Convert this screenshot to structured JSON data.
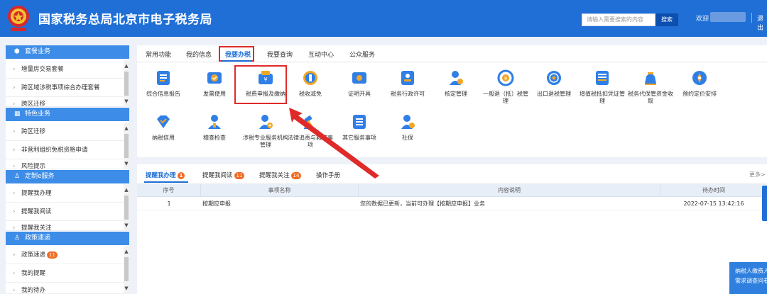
{
  "header": {
    "title": "国家税务总局北京市电子税务局",
    "search_placeholder": "请输入需要搜索的内容",
    "search_label": "搜索",
    "welcome": "欢迎",
    "logout": "退出",
    "brand_color": "#1f6fd6"
  },
  "sidebar": {
    "sections": [
      {
        "title": "套餐业务",
        "icon": "cube-icon",
        "items": [
          "增量房交易套餐",
          "跨区域涉税事项综合办理套餐",
          "跨区迁移"
        ]
      },
      {
        "title": "特色业务",
        "icon": "grid-icon",
        "items": [
          "跨区迁移",
          "非营利组织免税资格申请",
          "风险提示"
        ]
      },
      {
        "title": "定制e服务",
        "icon": "user-icon",
        "items": [
          "提醒我办理",
          "提醒我阅读",
          "提醒我关注"
        ]
      },
      {
        "title": "政策速递",
        "icon": "user-icon",
        "items": [
          "政策速递",
          "我的提醒",
          "我的待办"
        ],
        "badge": "11"
      }
    ]
  },
  "main_tabs": [
    "常用功能",
    "我的信息",
    "我要办税",
    "我要查询",
    "互动中心",
    "公众服务"
  ],
  "active_tab": "我要办税",
  "functions": [
    {
      "label": "综合信息报告",
      "icon": "document-icon"
    },
    {
      "label": "发票使用",
      "icon": "invoice-icon"
    },
    {
      "label": "税费申报及缴纳",
      "icon": "wallet-icon"
    },
    {
      "label": "税收减免",
      "icon": "coin-icon"
    },
    {
      "label": "证明开具",
      "icon": "certificate-icon"
    },
    {
      "label": "税务行政许可",
      "icon": "id-card-icon"
    },
    {
      "label": "核定管理",
      "icon": "person-icon"
    },
    {
      "label": "一般退（抵）税管理",
      "icon": "refund-icon"
    },
    {
      "label": "出口退税管理",
      "icon": "globe-icon"
    },
    {
      "label": "增值税抵扣凭证管理",
      "icon": "ledger-icon"
    },
    {
      "label": "税务代保管资金收取",
      "icon": "money-bag-icon"
    },
    {
      "label": "预约定价安排",
      "icon": "compass-icon"
    },
    {
      "label": "纳税信用",
      "icon": "diamond-icon"
    },
    {
      "label": "稽查检查",
      "icon": "inspector-icon"
    },
    {
      "label": "涉税专业服务机构管理",
      "icon": "agent-icon"
    },
    {
      "label": "法律追责与救济事项",
      "icon": "gavel-icon"
    },
    {
      "label": "其它服务事项",
      "icon": "list-icon"
    },
    {
      "label": "社保",
      "icon": "social-security-icon"
    }
  ],
  "reminder_tabs": [
    {
      "label": "提醒我办理",
      "badge": "1"
    },
    {
      "label": "提醒我阅读",
      "badge": "11"
    },
    {
      "label": "提醒我关注",
      "badge": "14"
    },
    {
      "label": "操作手册",
      "badge": ""
    }
  ],
  "more": "更多>",
  "table": {
    "headers": [
      "序号",
      "事项名称",
      "内容说明",
      "待办时间"
    ],
    "rows": [
      [
        "1",
        "按期应申报",
        "您的数据已更新，当前可办理【按期应申报】业务",
        "2022-07-15 13:42:16"
      ]
    ]
  },
  "notice": {
    "line1": "纳税人缴费人",
    "line2": "需求调查问卷"
  },
  "colors": {
    "accent": "#1f6fd6",
    "highlight": "#e02a2a",
    "badge": "#f26a21",
    "icon_primary": "#2f7fe6",
    "icon_secondary": "#f2a623"
  }
}
